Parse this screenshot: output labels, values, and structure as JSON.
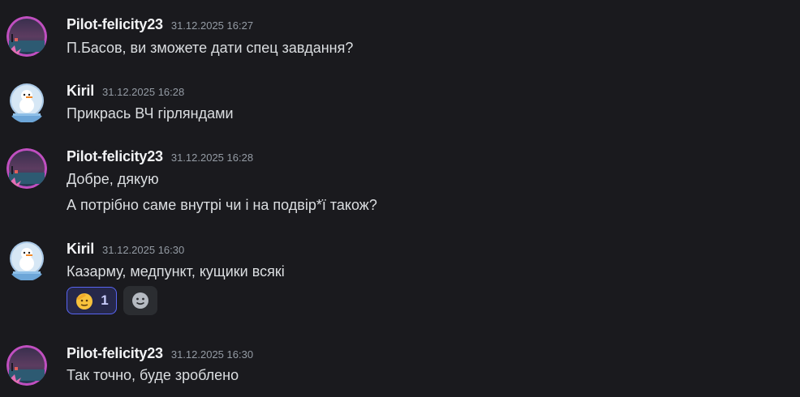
{
  "top_divider_text": "…",
  "messages": [
    {
      "author": "Pilot-felicity23",
      "timestamp": "31.12.2025 16:27",
      "lines": [
        "П.Басов, ви зможете дати спец завдання?"
      ],
      "avatar_icon": "sunset-pixel-avatar-icon"
    },
    {
      "author": "Kiril",
      "timestamp": "31.12.2025 16:28",
      "lines": [
        "Прикрась ВЧ гірляндами"
      ],
      "avatar_icon": "snowglobe-avatar-icon"
    },
    {
      "author": "Pilot-felicity23",
      "timestamp": "31.12.2025 16:28",
      "lines": [
        "Добре, дякую",
        "А потрібно саме внутрі чи і на подвір*ї також?"
      ],
      "avatar_icon": "sunset-pixel-avatar-icon"
    },
    {
      "author": "Kiril",
      "timestamp": "31.12.2025 16:30",
      "lines": [
        "Казарму, медпункт, кущики всякі"
      ],
      "avatar_icon": "snowglobe-avatar-icon",
      "reaction": {
        "emoji_icon": "saluting-face-icon",
        "count": "1"
      }
    },
    {
      "author": "Pilot-felicity23",
      "timestamp": "31.12.2025 16:30",
      "lines": [
        "Так точно, буде зроблено"
      ],
      "avatar_icon": "sunset-pixel-avatar-icon"
    }
  ],
  "colors": {
    "background": "#1a1a1e",
    "username": "#f2f3f5",
    "timestamp": "#949ba4",
    "reaction_border": "#5865f2"
  }
}
